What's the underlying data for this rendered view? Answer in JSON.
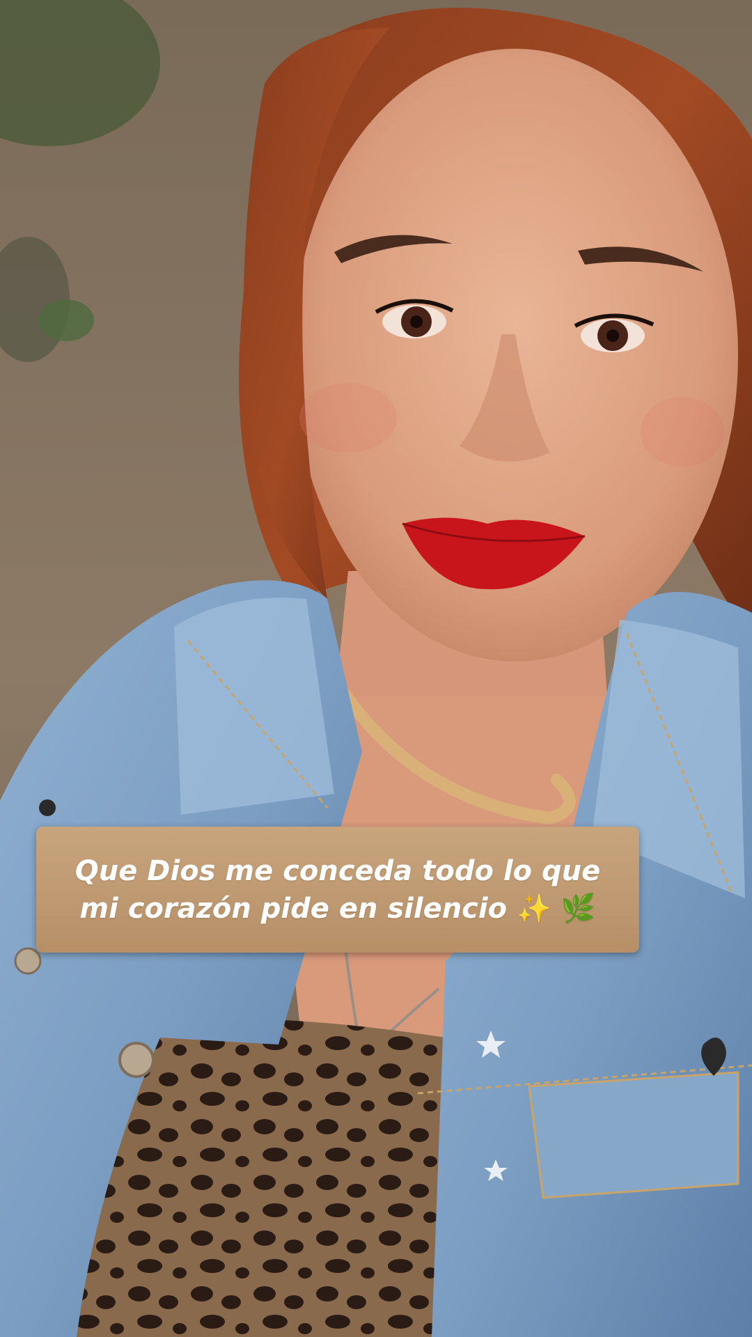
{
  "story": {
    "caption": {
      "line1": "Que Dios me conceda todo lo que",
      "line2": "mi corazón pide en silencio",
      "emoji_sparkles": "✨",
      "emoji_leaf": "🌿",
      "background_color": "#c29d74",
      "text_color": "#ffffff"
    }
  }
}
